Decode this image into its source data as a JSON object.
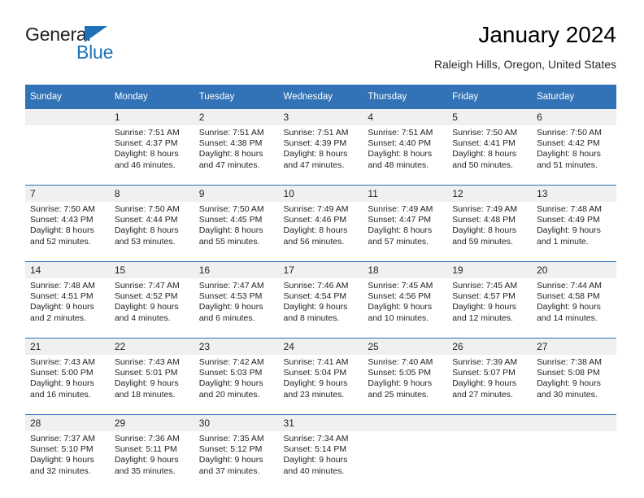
{
  "brand": {
    "name_part1": "General",
    "name_part2": "Blue",
    "triangle_icon": "brand-triangle-icon",
    "colors": {
      "blue": "#1d72b8",
      "dark": "#231f20"
    }
  },
  "header": {
    "title": "January 2024",
    "subtitle": "Raleigh Hills, Oregon, United States"
  },
  "theme": {
    "header_blue": "#3272b6",
    "row_shade": "#f0f0f0",
    "text": "#231f20"
  },
  "calendar": {
    "weekdays": [
      "Sunday",
      "Monday",
      "Tuesday",
      "Wednesday",
      "Thursday",
      "Friday",
      "Saturday"
    ],
    "weeks": [
      [
        {
          "day": "",
          "sunrise": "",
          "sunset": "",
          "daylight": "",
          "empty": true
        },
        {
          "day": "1",
          "sunrise": "Sunrise: 7:51 AM",
          "sunset": "Sunset: 4:37 PM",
          "daylight": "Daylight: 8 hours and 46 minutes."
        },
        {
          "day": "2",
          "sunrise": "Sunrise: 7:51 AM",
          "sunset": "Sunset: 4:38 PM",
          "daylight": "Daylight: 8 hours and 47 minutes."
        },
        {
          "day": "3",
          "sunrise": "Sunrise: 7:51 AM",
          "sunset": "Sunset: 4:39 PM",
          "daylight": "Daylight: 8 hours and 47 minutes."
        },
        {
          "day": "4",
          "sunrise": "Sunrise: 7:51 AM",
          "sunset": "Sunset: 4:40 PM",
          "daylight": "Daylight: 8 hours and 48 minutes."
        },
        {
          "day": "5",
          "sunrise": "Sunrise: 7:50 AM",
          "sunset": "Sunset: 4:41 PM",
          "daylight": "Daylight: 8 hours and 50 minutes."
        },
        {
          "day": "6",
          "sunrise": "Sunrise: 7:50 AM",
          "sunset": "Sunset: 4:42 PM",
          "daylight": "Daylight: 8 hours and 51 minutes."
        }
      ],
      [
        {
          "day": "7",
          "sunrise": "Sunrise: 7:50 AM",
          "sunset": "Sunset: 4:43 PM",
          "daylight": "Daylight: 8 hours and 52 minutes."
        },
        {
          "day": "8",
          "sunrise": "Sunrise: 7:50 AM",
          "sunset": "Sunset: 4:44 PM",
          "daylight": "Daylight: 8 hours and 53 minutes."
        },
        {
          "day": "9",
          "sunrise": "Sunrise: 7:50 AM",
          "sunset": "Sunset: 4:45 PM",
          "daylight": "Daylight: 8 hours and 55 minutes."
        },
        {
          "day": "10",
          "sunrise": "Sunrise: 7:49 AM",
          "sunset": "Sunset: 4:46 PM",
          "daylight": "Daylight: 8 hours and 56 minutes."
        },
        {
          "day": "11",
          "sunrise": "Sunrise: 7:49 AM",
          "sunset": "Sunset: 4:47 PM",
          "daylight": "Daylight: 8 hours and 57 minutes."
        },
        {
          "day": "12",
          "sunrise": "Sunrise: 7:49 AM",
          "sunset": "Sunset: 4:48 PM",
          "daylight": "Daylight: 8 hours and 59 minutes."
        },
        {
          "day": "13",
          "sunrise": "Sunrise: 7:48 AM",
          "sunset": "Sunset: 4:49 PM",
          "daylight": "Daylight: 9 hours and 1 minute."
        }
      ],
      [
        {
          "day": "14",
          "sunrise": "Sunrise: 7:48 AM",
          "sunset": "Sunset: 4:51 PM",
          "daylight": "Daylight: 9 hours and 2 minutes."
        },
        {
          "day": "15",
          "sunrise": "Sunrise: 7:47 AM",
          "sunset": "Sunset: 4:52 PM",
          "daylight": "Daylight: 9 hours and 4 minutes."
        },
        {
          "day": "16",
          "sunrise": "Sunrise: 7:47 AM",
          "sunset": "Sunset: 4:53 PM",
          "daylight": "Daylight: 9 hours and 6 minutes."
        },
        {
          "day": "17",
          "sunrise": "Sunrise: 7:46 AM",
          "sunset": "Sunset: 4:54 PM",
          "daylight": "Daylight: 9 hours and 8 minutes."
        },
        {
          "day": "18",
          "sunrise": "Sunrise: 7:45 AM",
          "sunset": "Sunset: 4:56 PM",
          "daylight": "Daylight: 9 hours and 10 minutes."
        },
        {
          "day": "19",
          "sunrise": "Sunrise: 7:45 AM",
          "sunset": "Sunset: 4:57 PM",
          "daylight": "Daylight: 9 hours and 12 minutes."
        },
        {
          "day": "20",
          "sunrise": "Sunrise: 7:44 AM",
          "sunset": "Sunset: 4:58 PM",
          "daylight": "Daylight: 9 hours and 14 minutes."
        }
      ],
      [
        {
          "day": "21",
          "sunrise": "Sunrise: 7:43 AM",
          "sunset": "Sunset: 5:00 PM",
          "daylight": "Daylight: 9 hours and 16 minutes."
        },
        {
          "day": "22",
          "sunrise": "Sunrise: 7:43 AM",
          "sunset": "Sunset: 5:01 PM",
          "daylight": "Daylight: 9 hours and 18 minutes."
        },
        {
          "day": "23",
          "sunrise": "Sunrise: 7:42 AM",
          "sunset": "Sunset: 5:03 PM",
          "daylight": "Daylight: 9 hours and 20 minutes."
        },
        {
          "day": "24",
          "sunrise": "Sunrise: 7:41 AM",
          "sunset": "Sunset: 5:04 PM",
          "daylight": "Daylight: 9 hours and 23 minutes."
        },
        {
          "day": "25",
          "sunrise": "Sunrise: 7:40 AM",
          "sunset": "Sunset: 5:05 PM",
          "daylight": "Daylight: 9 hours and 25 minutes."
        },
        {
          "day": "26",
          "sunrise": "Sunrise: 7:39 AM",
          "sunset": "Sunset: 5:07 PM",
          "daylight": "Daylight: 9 hours and 27 minutes."
        },
        {
          "day": "27",
          "sunrise": "Sunrise: 7:38 AM",
          "sunset": "Sunset: 5:08 PM",
          "daylight": "Daylight: 9 hours and 30 minutes."
        }
      ],
      [
        {
          "day": "28",
          "sunrise": "Sunrise: 7:37 AM",
          "sunset": "Sunset: 5:10 PM",
          "daylight": "Daylight: 9 hours and 32 minutes."
        },
        {
          "day": "29",
          "sunrise": "Sunrise: 7:36 AM",
          "sunset": "Sunset: 5:11 PM",
          "daylight": "Daylight: 9 hours and 35 minutes."
        },
        {
          "day": "30",
          "sunrise": "Sunrise: 7:35 AM",
          "sunset": "Sunset: 5:12 PM",
          "daylight": "Daylight: 9 hours and 37 minutes."
        },
        {
          "day": "31",
          "sunrise": "Sunrise: 7:34 AM",
          "sunset": "Sunset: 5:14 PM",
          "daylight": "Daylight: 9 hours and 40 minutes."
        },
        {
          "day": "",
          "sunrise": "",
          "sunset": "",
          "daylight": "",
          "empty": true
        },
        {
          "day": "",
          "sunrise": "",
          "sunset": "",
          "daylight": "",
          "empty": true
        },
        {
          "day": "",
          "sunrise": "",
          "sunset": "",
          "daylight": "",
          "empty": true
        }
      ]
    ]
  }
}
